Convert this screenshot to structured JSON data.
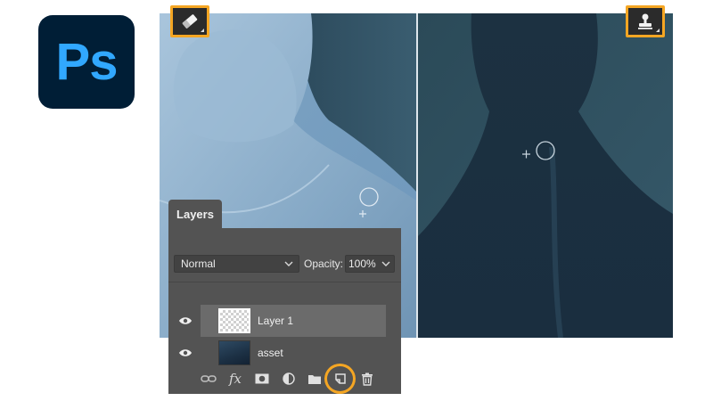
{
  "app": {
    "logo_text": "Ps",
    "brand_bg": "#001e36",
    "brand_fg": "#31a8ff",
    "accent": "#f5a623"
  },
  "tools": {
    "left_tool_icon": "eraser-icon",
    "right_tool_icon": "clone-stamp-icon"
  },
  "layers_panel": {
    "tab_label": "Layers",
    "blend_mode": "Normal",
    "opacity_label": "Opacity:",
    "opacity_value": "100%",
    "layers": [
      {
        "name": "Layer 1",
        "visible": true,
        "selected": true,
        "thumbnail": "transparent"
      },
      {
        "name": "asset",
        "visible": true,
        "selected": false,
        "thumbnail": "image"
      }
    ],
    "bottom_icons": [
      "link-layers-icon",
      "layer-style-fx-icon",
      "layer-mask-icon",
      "adjustment-layer-icon",
      "new-group-folder-icon",
      "new-layer-icon",
      "delete-layer-icon"
    ],
    "fx_label": "fx"
  }
}
